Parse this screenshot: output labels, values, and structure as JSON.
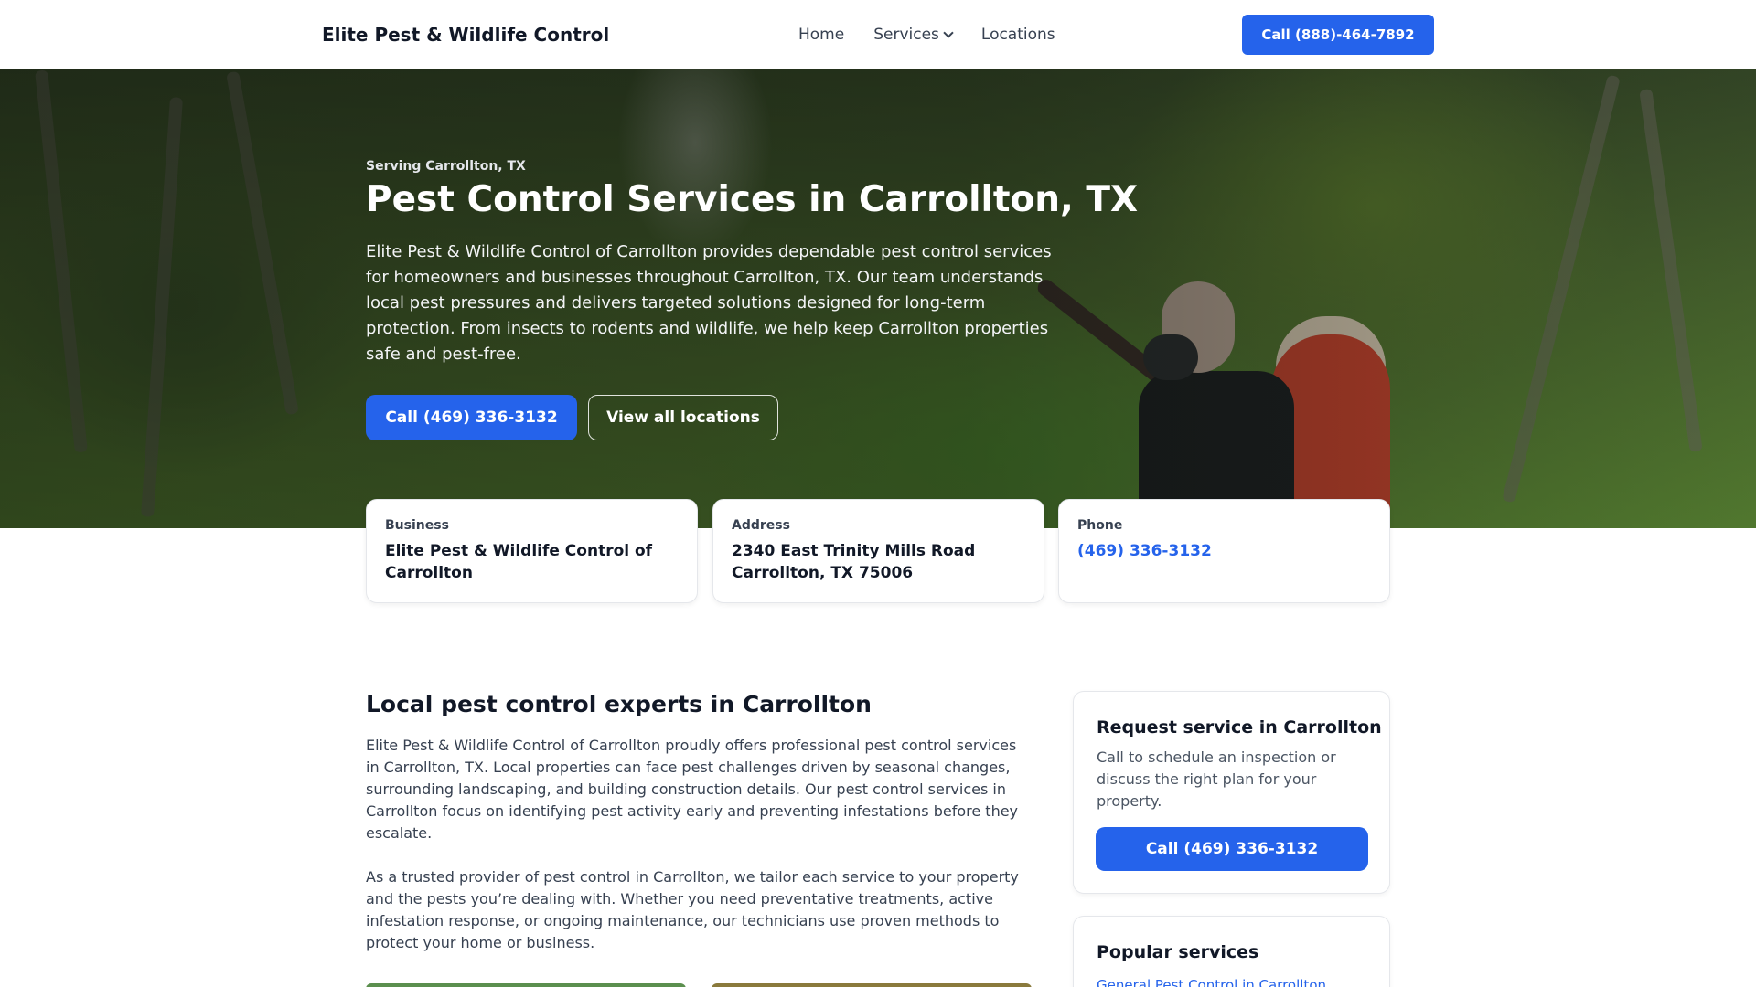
{
  "header": {
    "brand": "Elite Pest & Wildlife Control",
    "nav": [
      {
        "label": "Home"
      },
      {
        "label": "Services"
      },
      {
        "label": "Locations"
      }
    ],
    "cta": "Call (888)-464-7892"
  },
  "hero": {
    "eyebrow": "Serving Carrollton, TX",
    "title": "Pest Control Services in Carrollton, TX",
    "description": "Elite Pest & Wildlife Control of Carrollton provides dependable pest control services for homeowners and businesses throughout Carrollton, TX. Our team understands local pest pressures and delivers targeted solutions designed for long-term protection. From insects to rodents and wildlife, we help keep Carrollton properties safe and pest-free.",
    "primary_button": "Call (469) 336-3132",
    "secondary_button": "View all locations"
  },
  "info_cards": [
    {
      "label": "Business",
      "value": "Elite Pest & Wildlife Control of Carrollton"
    },
    {
      "label": "Address",
      "line1": "2340 East Trinity Mills Road",
      "line2": "Carrollton, TX 75006"
    },
    {
      "label": "Phone",
      "value": "(469) 336-3132"
    }
  ],
  "main": {
    "title": "Local pest control experts in Carrollton",
    "paragraphs": [
      "Elite Pest & Wildlife Control of Carrollton proudly offers professional pest control services in Carrollton, TX. Local properties can face pest challenges driven by seasonal changes, surrounding landscaping, and building construction details. Our pest control services in Carrollton focus on identifying pest activity early and preventing infestations before they escalate.",
      "As a trusted provider of pest control in Carrollton, we tailor each service to your property and the pests you’re dealing with. Whether you need preventative treatments, active infestation response, or ongoing maintenance, our technicians use proven methods to protect your home or business."
    ]
  },
  "sidebar": {
    "request": {
      "title": "Request service in Carrollton",
      "text": "Call to schedule an inspection or discuss the right plan for your property.",
      "button": "Call (469) 336-3132"
    },
    "popular": {
      "title": "Popular services",
      "first_link": "General Pest Control in Carrollton"
    }
  },
  "colors": {
    "accent": "#2563eb",
    "text_dark": "#111827"
  }
}
